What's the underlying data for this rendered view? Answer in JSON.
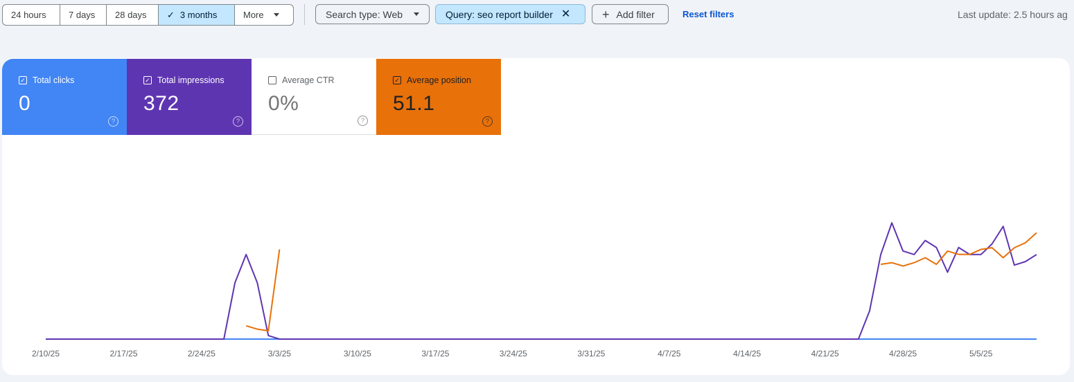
{
  "toolbar": {
    "date_ranges": [
      {
        "label": "24 hours",
        "active": false
      },
      {
        "label": "7 days",
        "active": false
      },
      {
        "label": "28 days",
        "active": false
      },
      {
        "label": "3 months",
        "active": true
      },
      {
        "label": "More",
        "active": false
      }
    ],
    "search_type_label": "Search type: Web",
    "query_filter_label": "Query: seo report builder",
    "add_filter_label": "Add filter",
    "reset_filters_label": "Reset filters",
    "last_update": "Last update: 2.5 hours ag"
  },
  "metrics": {
    "clicks": {
      "label": "Total clicks",
      "value": "0",
      "checked": true,
      "color": "#4285f4"
    },
    "impressions": {
      "label": "Total impressions",
      "value": "372",
      "checked": true,
      "color": "#5e35b1"
    },
    "ctr": {
      "label": "Average CTR",
      "value": "0%",
      "checked": false,
      "color": "#ffffff"
    },
    "position": {
      "label": "Average position",
      "value": "51.1",
      "checked": true,
      "color": "#e8710a"
    }
  },
  "chart_data": {
    "type": "line",
    "x_tick_labels": [
      "2/10/25",
      "2/17/25",
      "2/24/25",
      "3/3/25",
      "3/10/25",
      "3/17/25",
      "3/24/25",
      "3/31/25",
      "4/7/25",
      "4/14/25",
      "4/21/25",
      "4/28/25",
      "5/5/25"
    ],
    "x_start": "2/10/25",
    "x_end": "5/10/25",
    "y_axis_shown": false,
    "grid": false,
    "series": [
      {
        "name": "Total clicks",
        "color": "#4285f4",
        "points": [
          [
            "2/10/25",
            0
          ],
          [
            "5/10/25",
            0
          ]
        ]
      },
      {
        "name": "Total impressions",
        "color": "#5e35b1",
        "points": [
          [
            "2/10/25",
            0
          ],
          [
            "2/26/25",
            0
          ],
          [
            "2/27/25",
            8
          ],
          [
            "2/28/25",
            12
          ],
          [
            "3/1/25",
            8
          ],
          [
            "3/2/25",
            0.5
          ],
          [
            "3/3/25",
            0
          ],
          [
            "4/24/25",
            0
          ],
          [
            "4/25/25",
            4
          ],
          [
            "4/26/25",
            12
          ],
          [
            "4/27/25",
            16.5
          ],
          [
            "4/28/25",
            12.5
          ],
          [
            "4/29/25",
            12
          ],
          [
            "4/30/25",
            14
          ],
          [
            "5/1/25",
            13
          ],
          [
            "5/2/25",
            9.5
          ],
          [
            "5/3/25",
            13
          ],
          [
            "5/4/25",
            12
          ],
          [
            "5/5/25",
            12
          ],
          [
            "5/6/25",
            13.5
          ],
          [
            "5/7/25",
            16
          ],
          [
            "5/8/25",
            10.5
          ],
          [
            "5/9/25",
            11
          ],
          [
            "5/10/25",
            12
          ]
        ]
      },
      {
        "name": "Average position",
        "color": "#e8710a",
        "segments": [
          [
            [
              "2/28/25",
              62
            ],
            [
              "3/1/25",
              64
            ],
            [
              "3/2/25",
              65
            ],
            [
              "3/3/25",
              16
            ]
          ],
          [
            [
              "4/26/25",
              25
            ],
            [
              "4/27/25",
              24
            ],
            [
              "4/28/25",
              26
            ],
            [
              "4/29/25",
              24
            ],
            [
              "4/30/25",
              21
            ],
            [
              "5/1/25",
              25
            ],
            [
              "5/2/25",
              17
            ],
            [
              "5/3/25",
              19
            ],
            [
              "5/4/25",
              19
            ],
            [
              "5/5/25",
              16
            ],
            [
              "5/6/25",
              15
            ],
            [
              "5/7/25",
              21
            ],
            [
              "5/8/25",
              15
            ],
            [
              "5/9/25",
              12
            ],
            [
              "5/10/25",
              6
            ]
          ]
        ]
      }
    ]
  }
}
